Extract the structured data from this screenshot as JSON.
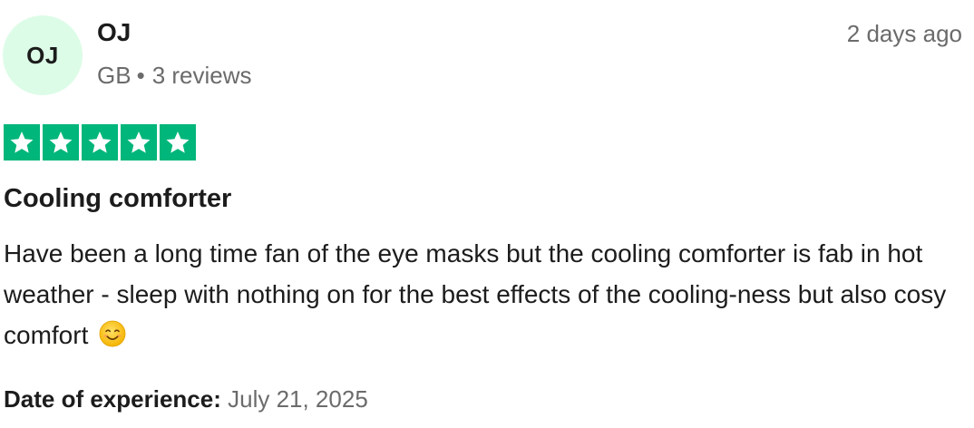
{
  "reviewer": {
    "initials": "OJ",
    "name": "OJ",
    "country": "GB",
    "separator": "•",
    "review_count": "3 reviews",
    "avatar_color": "#dcfce7"
  },
  "review": {
    "posted": "2 days ago",
    "rating": 5,
    "rating_max": 5,
    "star_color": "#00b67a",
    "title": "Cooling comforter",
    "text": "Have been a long time fan of the eye masks but the cooling comforter is fab in hot weather - sleep with nothing on for the best effects of the cooling-ness but also cosy comfort",
    "emoji": "smiling-face-icon",
    "experience_label": "Date of experience:",
    "experience_date": "July 21, 2025"
  }
}
